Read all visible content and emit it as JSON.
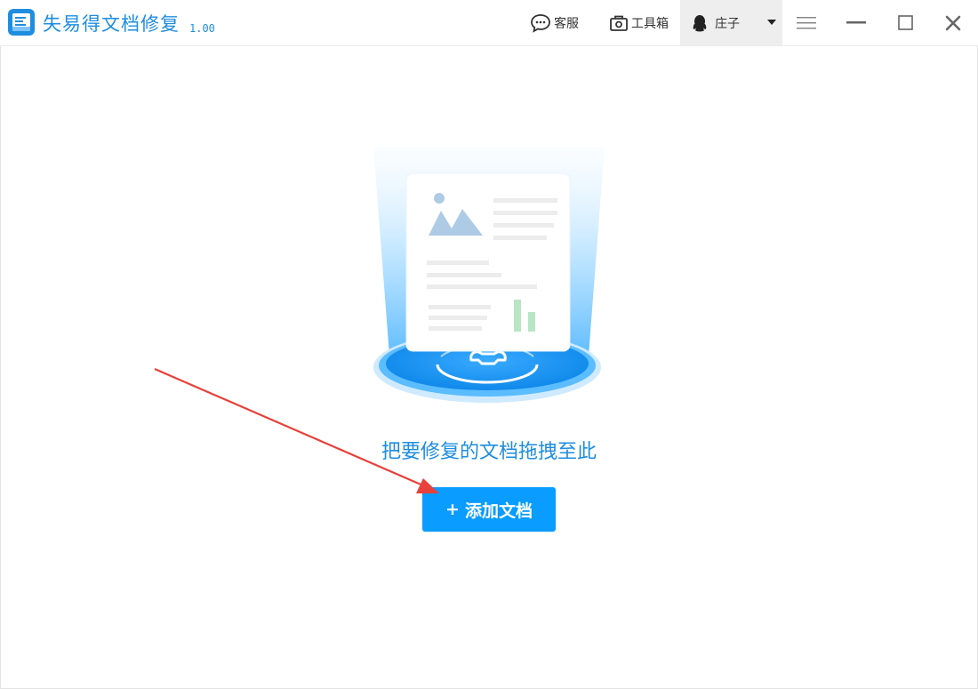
{
  "app": {
    "title": "失易得文档修复",
    "version": "1.00"
  },
  "titlebar": {
    "service_label": "客服",
    "toolbox_label": "工具箱",
    "user_name": "庄子"
  },
  "main": {
    "drop_hint": "把要修复的文档拖拽至此",
    "add_button_label": "添加文档"
  },
  "icons": {
    "app_logo": "document-repair-logo-icon",
    "service": "chat-bubble-icon",
    "toolbox": "toolbox-icon",
    "user": "qq-penguin-icon",
    "dropdown": "caret-down-icon",
    "menu": "hamburger-menu-icon",
    "minimize": "minimize-icon",
    "maximize": "maximize-icon",
    "close": "close-icon"
  },
  "colors": {
    "brand": "#1e8de0",
    "button": "#0a9cff",
    "annotation_arrow": "#e8403a"
  }
}
